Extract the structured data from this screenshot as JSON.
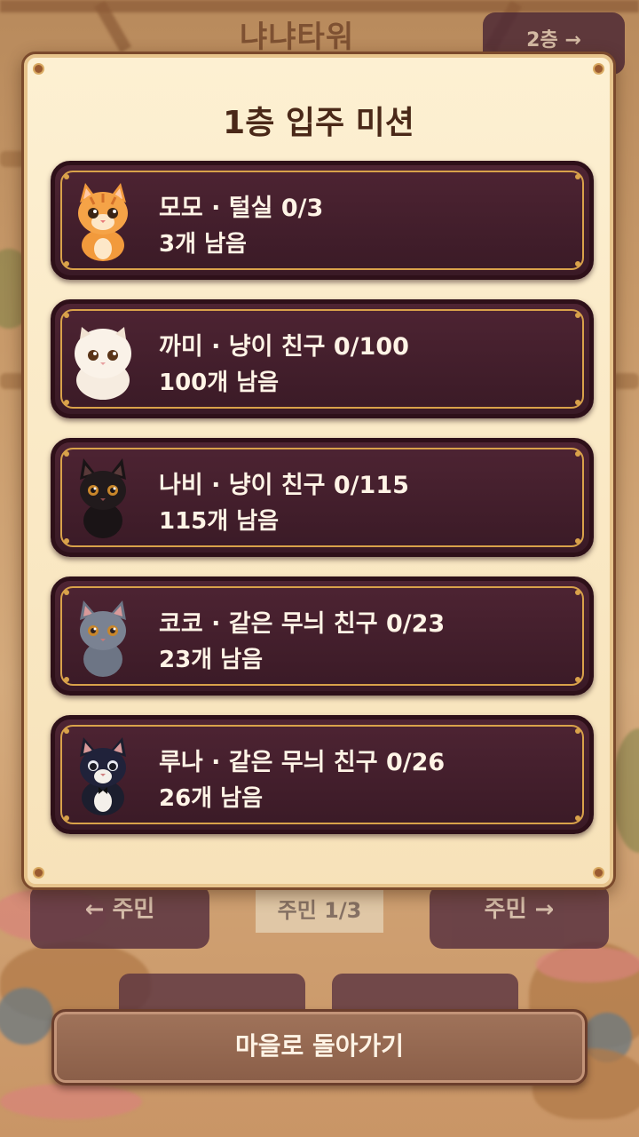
{
  "background": {
    "game_title": "냐냐타워",
    "floor_button": "2층 →",
    "resident_prev": "← 주민",
    "resident_count": "주민 1/3",
    "resident_next": "주민 →"
  },
  "modal": {
    "title": "1층 입주 미션",
    "missions": [
      {
        "cat": "orange-tabby-cat",
        "title": "모모 · 털실 0/3",
        "remaining": "3개 남음"
      },
      {
        "cat": "white-persian-cat",
        "title": "까미 · 냥이 친구 0/100",
        "remaining": "100개 남음"
      },
      {
        "cat": "black-cat",
        "title": "나비 · 냥이 친구 0/115",
        "remaining": "115개 남음"
      },
      {
        "cat": "gray-cat",
        "title": "코코 · 같은 무늬 친구 0/23",
        "remaining": "23개 남음"
      },
      {
        "cat": "tuxedo-cat",
        "title": "루나 · 같은 무늬 친구 0/26",
        "remaining": "26개 남음"
      }
    ]
  },
  "footer": {
    "back_label": "마을로 돌아가기"
  },
  "colors": {
    "panel": "#fdf0d2",
    "card": "#4e2433",
    "card_border": "#d9a24a",
    "button": "#a0735a"
  }
}
